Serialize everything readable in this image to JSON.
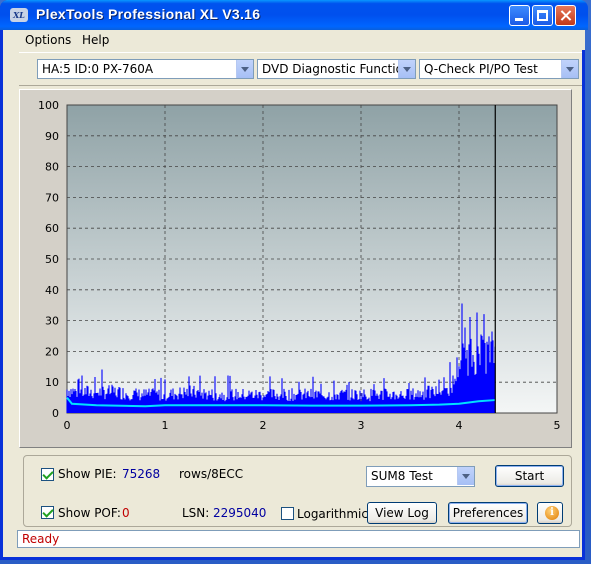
{
  "window": {
    "title": "PlexTools Professional XL V3.16",
    "icon_text": "XL"
  },
  "menu": {
    "options": "Options",
    "help": "Help"
  },
  "toolbar": {
    "drive": "HA:5 ID:0  PX-760A",
    "function": "DVD Diagnostic Functions",
    "test": "Q-Check PI/PO Test"
  },
  "chart_data": {
    "type": "area",
    "xlim": [
      0,
      5
    ],
    "ylim": [
      0,
      100
    ],
    "x_ticks": [
      "0",
      "1",
      "2",
      "3",
      "4",
      "5"
    ],
    "y_ticks": [
      "0",
      "10",
      "20",
      "30",
      "40",
      "50",
      "60",
      "70",
      "80",
      "90",
      "100"
    ],
    "grid": true,
    "end_marker_x": 4.37,
    "series": [
      {
        "color": "#0000ff",
        "x": [
          0.0,
          0.1,
          0.25,
          0.5,
          0.75,
          1.0,
          1.25,
          1.5,
          1.75,
          2.0,
          2.25,
          2.5,
          2.75,
          3.0,
          3.25,
          3.5,
          3.75,
          3.9,
          3.95,
          4.0,
          4.1,
          4.2,
          4.3,
          4.37
        ],
        "y": [
          9,
          8,
          8,
          8,
          7,
          7,
          8,
          7,
          7,
          7,
          7,
          7,
          7,
          7,
          7,
          7,
          8,
          9,
          12,
          20,
          22,
          22,
          23,
          24
        ]
      },
      {
        "color": "#00e0ff",
        "x": [
          0.0,
          0.05,
          0.3,
          0.8,
          1.0,
          1.5,
          2.0,
          2.5,
          3.0,
          3.5,
          3.8,
          4.0,
          4.2,
          4.37
        ],
        "y": [
          5,
          3,
          2.5,
          2.2,
          2.5,
          2.5,
          2.5,
          2.4,
          2.4,
          2.5,
          2.7,
          3,
          3.8,
          4.2
        ]
      }
    ]
  },
  "controls": {
    "show_pie_label": "Show PIE:",
    "pie_value": "75268",
    "pie_unit": "rows/8ECC",
    "show_pof_label": "Show POF:",
    "pof_value": "0",
    "lsn_label": "LSN:",
    "lsn_value": "2295040",
    "logarithmic_label": "Logarithmic",
    "sum_select": "SUM8 Test",
    "start_button": "Start",
    "view_log_button": "View Log",
    "preferences_button": "Preferences",
    "info_icon_text": "i"
  },
  "status": {
    "text": "Ready"
  }
}
